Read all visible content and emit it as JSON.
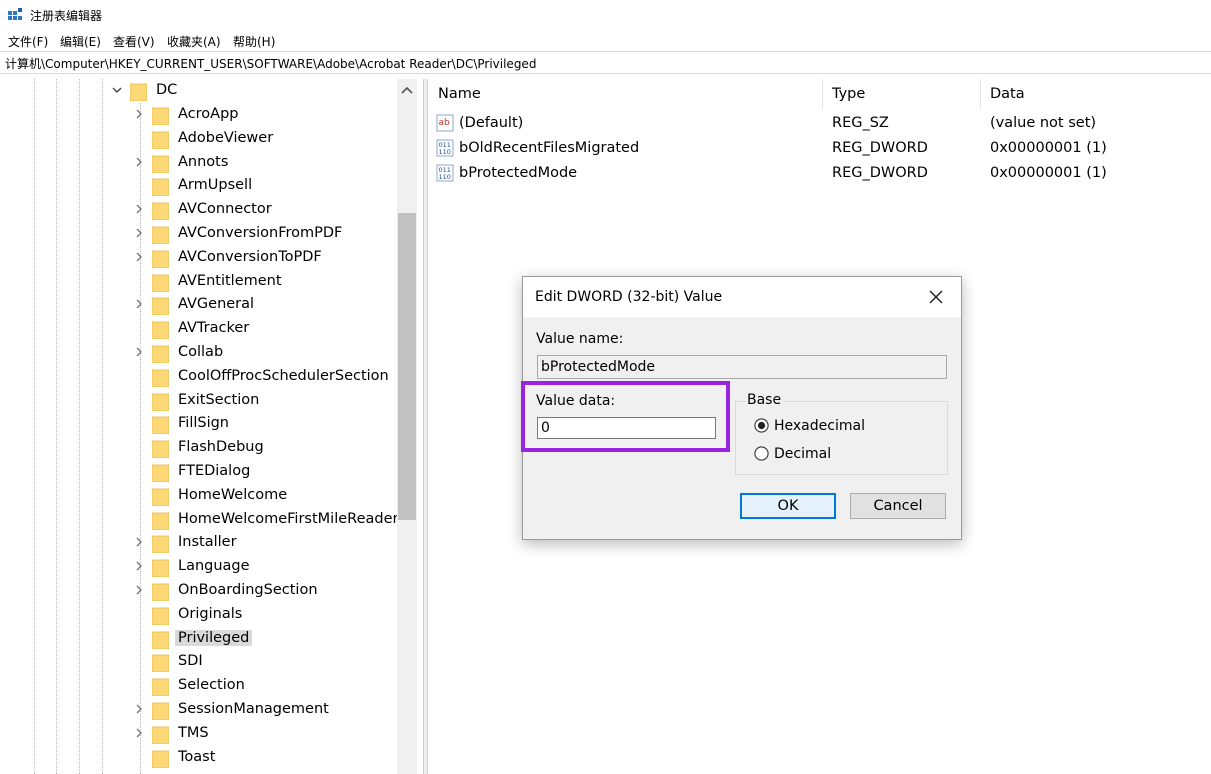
{
  "window": {
    "title": "注册表编辑器"
  },
  "menu": [
    "文件(F)",
    "编辑(E)",
    "查看(V)",
    "收藏夹(A)",
    "帮助(H)"
  ],
  "address": "计算机\\Computer\\HKEY_CURRENT_USER\\SOFTWARE\\Adobe\\Acrobat Reader\\DC\\Privileged",
  "tree": {
    "parent": "DC",
    "items": [
      {
        "label": "AcroApp",
        "expandable": true
      },
      {
        "label": "AdobeViewer",
        "expandable": false
      },
      {
        "label": "Annots",
        "expandable": true
      },
      {
        "label": "ArmUpsell",
        "expandable": false
      },
      {
        "label": "AVConnector",
        "expandable": true
      },
      {
        "label": "AVConversionFromPDF",
        "expandable": true
      },
      {
        "label": "AVConversionToPDF",
        "expandable": true
      },
      {
        "label": "AVEntitlement",
        "expandable": false
      },
      {
        "label": "AVGeneral",
        "expandable": true
      },
      {
        "label": "AVTracker",
        "expandable": false
      },
      {
        "label": "Collab",
        "expandable": true
      },
      {
        "label": "CoolOffProcSchedulerSection",
        "expandable": false
      },
      {
        "label": "ExitSection",
        "expandable": false
      },
      {
        "label": "FillSign",
        "expandable": false
      },
      {
        "label": "FlashDebug",
        "expandable": false
      },
      {
        "label": "FTEDialog",
        "expandable": false
      },
      {
        "label": "HomeWelcome",
        "expandable": false
      },
      {
        "label": "HomeWelcomeFirstMileReader",
        "expandable": false
      },
      {
        "label": "Installer",
        "expandable": true
      },
      {
        "label": "Language",
        "expandable": true
      },
      {
        "label": "OnBoardingSection",
        "expandable": true
      },
      {
        "label": "Originals",
        "expandable": false
      },
      {
        "label": "Privileged",
        "expandable": false,
        "selected": true
      },
      {
        "label": "SDI",
        "expandable": false
      },
      {
        "label": "Selection",
        "expandable": false
      },
      {
        "label": "SessionManagement",
        "expandable": true
      },
      {
        "label": "TMS",
        "expandable": true
      },
      {
        "label": "Toast",
        "expandable": false
      }
    ]
  },
  "list": {
    "headers": {
      "name": "Name",
      "type": "Type",
      "data": "Data"
    },
    "rows": [
      {
        "icon": "string-value-icon",
        "name": "(Default)",
        "type": "REG_SZ",
        "data": "(value not set)"
      },
      {
        "icon": "binary-value-icon",
        "name": "bOldRecentFilesMigrated",
        "type": "REG_DWORD",
        "data": "0x00000001 (1)"
      },
      {
        "icon": "binary-value-icon",
        "name": "bProtectedMode",
        "type": "REG_DWORD",
        "data": "0x00000001 (1)"
      }
    ]
  },
  "dialog": {
    "title": "Edit DWORD (32-bit) Value",
    "value_name_label": "Value name:",
    "value_name": "bProtectedMode",
    "value_data_label": "Value data:",
    "value_data": "0",
    "base_label": "Base",
    "hex_label": "Hexadecimal",
    "dec_label": "Decimal",
    "base_selected": "Hexadecimal",
    "ok_label": "OK",
    "cancel_label": "Cancel"
  },
  "colors": {
    "highlight": "#9b22e0",
    "folder": "#fcd877",
    "selected_row": "#d9d9d9",
    "ok_border": "#0078d7"
  }
}
